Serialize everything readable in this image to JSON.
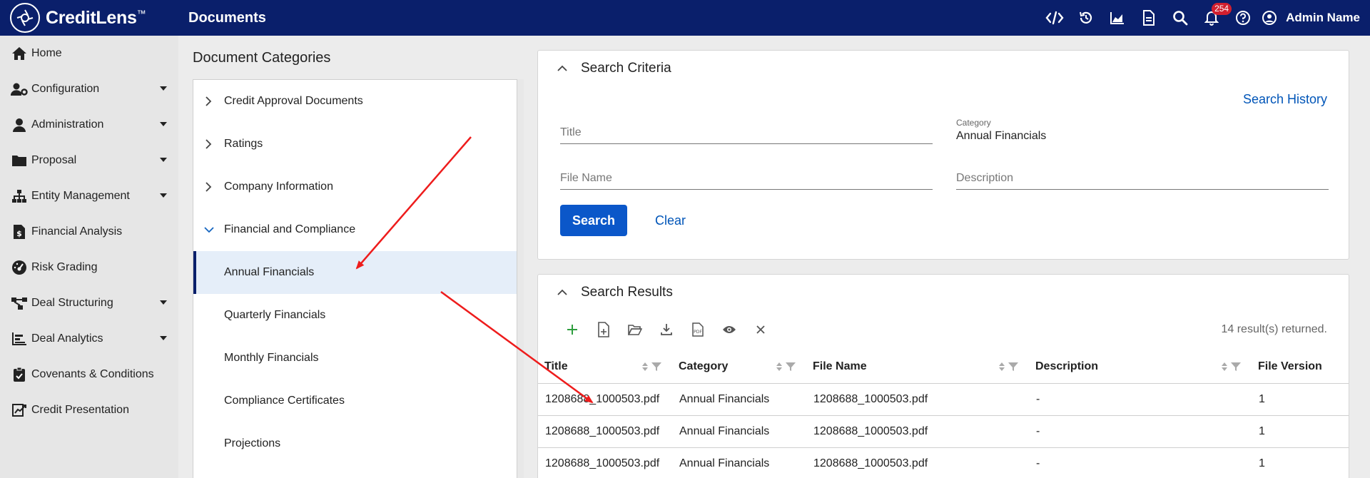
{
  "app": {
    "name": "CreditLens",
    "tm": "™",
    "page_title": "Documents"
  },
  "topbar": {
    "notification_count": "254",
    "user_name": "Admin Name"
  },
  "sidebar": {
    "items": [
      {
        "label": "Home",
        "icon": "home-icon"
      },
      {
        "label": "Configuration",
        "icon": "user-gear-icon",
        "has_children": true
      },
      {
        "label": "Administration",
        "icon": "user-icon",
        "has_children": true
      },
      {
        "label": "Proposal",
        "icon": "folder-icon",
        "has_children": true
      },
      {
        "label": "Entity Management",
        "icon": "hierarchy-icon",
        "has_children": true
      },
      {
        "label": "Financial Analysis",
        "icon": "dollar-doc-icon"
      },
      {
        "label": "Risk Grading",
        "icon": "gauge-icon"
      },
      {
        "label": "Deal Structuring",
        "icon": "flow-icon",
        "has_children": true
      },
      {
        "label": "Deal Analytics",
        "icon": "bar-chart-icon",
        "has_children": true
      },
      {
        "label": "Covenants & Conditions",
        "icon": "clipboard-check-icon"
      },
      {
        "label": "Credit Presentation",
        "icon": "presentation-icon"
      }
    ]
  },
  "categories": {
    "title": "Document Categories",
    "items": [
      {
        "label": "Credit Approval Documents",
        "state": "collapsed"
      },
      {
        "label": "Ratings",
        "state": "collapsed"
      },
      {
        "label": "Company Information",
        "state": "collapsed"
      },
      {
        "label": "Financial and Compliance",
        "state": "expanded"
      },
      {
        "label": "Annual Financials",
        "state": "child-selected"
      },
      {
        "label": "Quarterly Financials",
        "state": "child"
      },
      {
        "label": "Monthly Financials",
        "state": "child"
      },
      {
        "label": "Compliance Certificates",
        "state": "child"
      },
      {
        "label": "Projections",
        "state": "child"
      }
    ]
  },
  "search": {
    "title": "Search Criteria",
    "history_link": "Search History",
    "title_placeholder": "Title",
    "category_label": "Category",
    "category_value": "Annual Financials",
    "filename_placeholder": "File Name",
    "description_placeholder": "Description",
    "search_button": "Search",
    "clear_button": "Clear"
  },
  "results": {
    "title": "Search Results",
    "count_text": "14 result(s) returned.",
    "columns": [
      "Title",
      "Category",
      "File Name",
      "Description",
      "File Version"
    ],
    "rows": [
      [
        "1208688_1000503.pdf",
        "Annual Financials",
        "1208688_1000503.pdf",
        "-",
        "1"
      ],
      [
        "1208688_1000503.pdf",
        "Annual Financials",
        "1208688_1000503.pdf",
        "-",
        "1"
      ],
      [
        "1208688_1000503.pdf",
        "Annual Financials",
        "1208688_1000503.pdf",
        "-",
        "1"
      ]
    ]
  },
  "colors": {
    "nav_bg": "#0a1f6b",
    "primary": "#0b57c9",
    "link": "#0055b8",
    "annotation": "#ee1c1c",
    "selected_bg": "#e5eef9"
  }
}
